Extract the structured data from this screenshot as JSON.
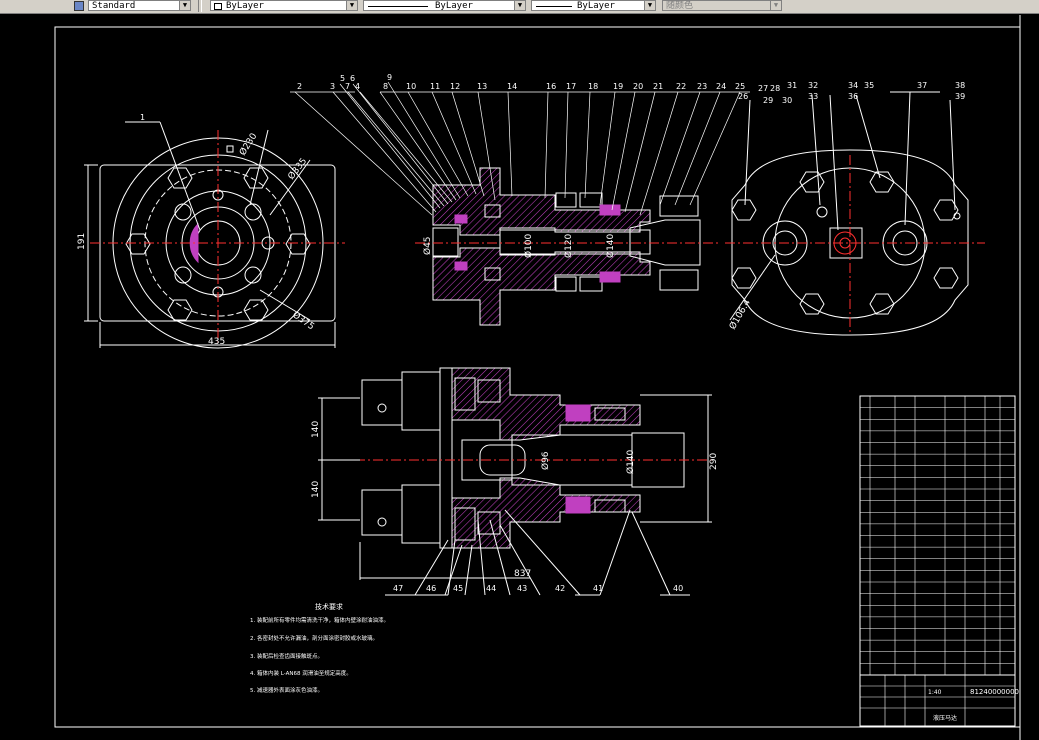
{
  "toolbar": {
    "text_style": "Standard",
    "layer_value": "ByLayer",
    "linetype_value": "ByLayer",
    "lineweight_value": "ByLayer",
    "plotstyle_value": "随颜色"
  },
  "drawing": {
    "leaders_top": [
      "2",
      "3",
      "4",
      "5",
      "6",
      "7",
      "8",
      "9",
      "10",
      "11",
      "12",
      "13",
      "14",
      "16",
      "17",
      "18",
      "19",
      "20",
      "21",
      "22",
      "23",
      "24",
      "25",
      "26",
      "27",
      "28",
      "29",
      "30",
      "31",
      "32",
      "33",
      "34",
      "35",
      "36",
      "37",
      "38",
      "39"
    ],
    "leader_1": "1",
    "leaders_bottom": [
      "40",
      "41",
      "42",
      "43",
      "44",
      "45",
      "46",
      "47"
    ],
    "dims": {
      "d_230": "Ø230",
      "d_335": "Ø335",
      "d_375": "Ø375",
      "w_435": "435",
      "h_191": "191",
      "d_45": "Ø45",
      "d_100": "Ø100",
      "d_120": "Ø120",
      "d_140_top": "Ø140",
      "d_106": "Ø106.4",
      "h_140a": "140",
      "h_140b": "140",
      "h_290": "290",
      "d_96": "Ø96",
      "d_140_bot": "Ø140",
      "w_837": "837"
    },
    "notes_title": "技术要求",
    "notes": [
      "1. 装配前所有零件均需清洗干净，箱体内壁涂耐油油漆。",
      "2. 各密封处不允许漏油，剖分面涂密封胶或水玻璃。",
      "3. 装配后检查齿面接触斑点。",
      "4. 箱体内装 L-AN68 润滑油至规定高度。",
      "5. 减速器外表面涂灰色油漆。"
    ]
  },
  "title_block": {
    "drawing_no": "81240000000",
    "scale": "1:40",
    "name": "液压马达",
    "sub_rows": 24
  }
}
